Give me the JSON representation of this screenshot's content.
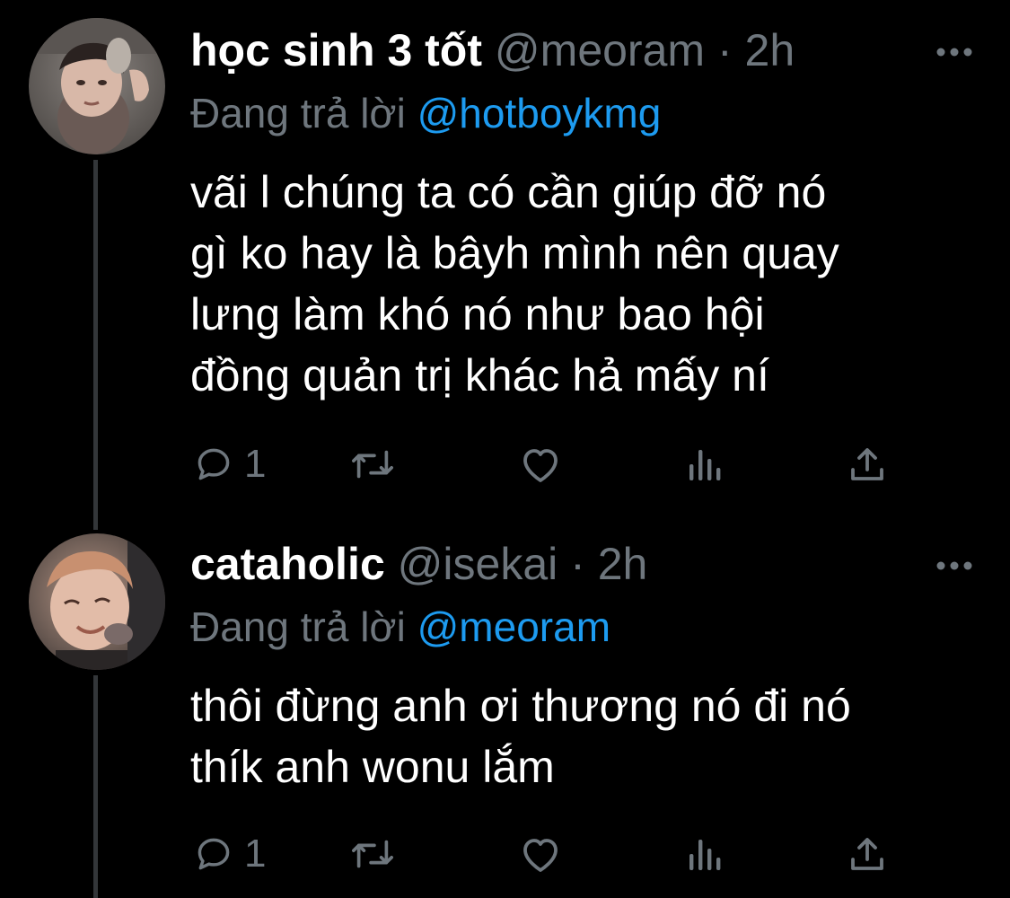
{
  "tweets": [
    {
      "name": "học sinh 3 tốt",
      "handle": "@meoram",
      "separator": "·",
      "time": "2h",
      "replying_prefix": "Đang trả lời",
      "replying_to": "@hotboykmg",
      "body_lines": [
        "vãi l chúng ta có cần giúp đỡ nó",
        "gì ko hay là bâyh mình nên quay",
        "lưng làm khó nó như bao hội",
        "đồng quản trị khác hả mấy ní"
      ],
      "reply_count": "1",
      "avatar_icon": "user-avatar"
    },
    {
      "name": "cataholic",
      "handle": "@isekai",
      "separator": "·",
      "time": "2h",
      "replying_prefix": "Đang trả lời",
      "replying_to": "@meoram",
      "body_lines": [
        "thôi đừng anh ơi thương nó đi nó",
        "thík anh wonu lắm"
      ],
      "reply_count": "1",
      "avatar_icon": "user-avatar"
    }
  ],
  "icons": {
    "more": "more-icon",
    "reply": "reply-icon",
    "retweet": "retweet-icon",
    "like": "like-icon",
    "views": "views-icon",
    "share": "share-icon"
  },
  "colors": {
    "background": "#000000",
    "text": "#ffffff",
    "muted": "#6e767d",
    "link": "#1d9bf0",
    "thread_line": "#333639"
  }
}
